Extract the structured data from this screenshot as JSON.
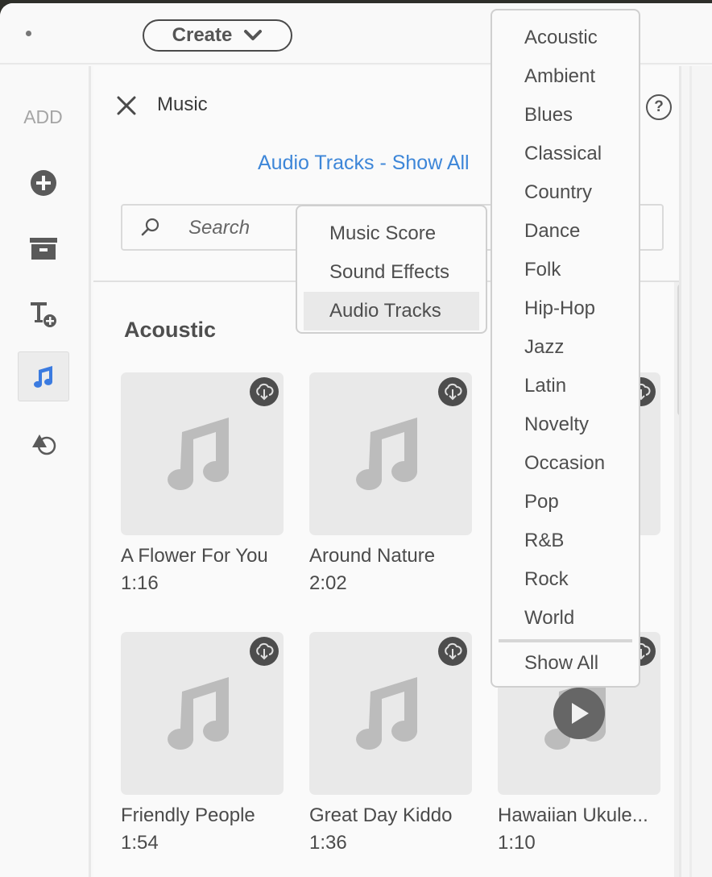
{
  "topbar": {
    "create_label": "Create",
    "create_icon": "chevron-down-icon"
  },
  "sidebar": {
    "heading": "ADD",
    "items": [
      {
        "name": "add-media",
        "icon": "plus-circle-icon",
        "active": false
      },
      {
        "name": "archive",
        "icon": "archive-box-icon",
        "active": false
      },
      {
        "name": "add-text",
        "icon": "text-add-icon",
        "active": false
      },
      {
        "name": "music",
        "icon": "music-note-icon",
        "active": true
      },
      {
        "name": "shapes",
        "icon": "shapes-icon",
        "active": false
      }
    ]
  },
  "panel": {
    "title": "Music",
    "close_icon": "close-icon",
    "help_icon": "help-icon",
    "help_glyph": "?",
    "filter_link": "Audio Tracks - Show All",
    "search": {
      "placeholder": "Search",
      "value": ""
    },
    "section_title": "Acoustic",
    "tracks": [
      {
        "title": "A Flower For You",
        "duration": "1:16"
      },
      {
        "title": "Around Nature",
        "duration": "2:02"
      },
      {
        "title": "",
        "duration": ""
      },
      {
        "title": "Friendly People",
        "duration": "1:54"
      },
      {
        "title": "Great Day Kiddo",
        "duration": "1:36"
      },
      {
        "title": "Hawaiian Ukule...",
        "duration": "1:10"
      }
    ]
  },
  "type_menu": {
    "items": [
      "Music Score",
      "Sound Effects",
      "Audio Tracks"
    ],
    "selected": "Audio Tracks"
  },
  "genre_menu": {
    "items": [
      "Acoustic",
      "Ambient",
      "Blues",
      "Classical",
      "Country",
      "Dance",
      "Folk",
      "Hip-Hop",
      "Jazz",
      "Latin",
      "Novelty",
      "Occasion",
      "Pop",
      "R&B",
      "Rock",
      "World"
    ],
    "show_all": "Show All"
  },
  "colors": {
    "accent": "#3d86d8",
    "active_icon": "#3b7be0",
    "icon_gray": "#5a5a5a"
  }
}
